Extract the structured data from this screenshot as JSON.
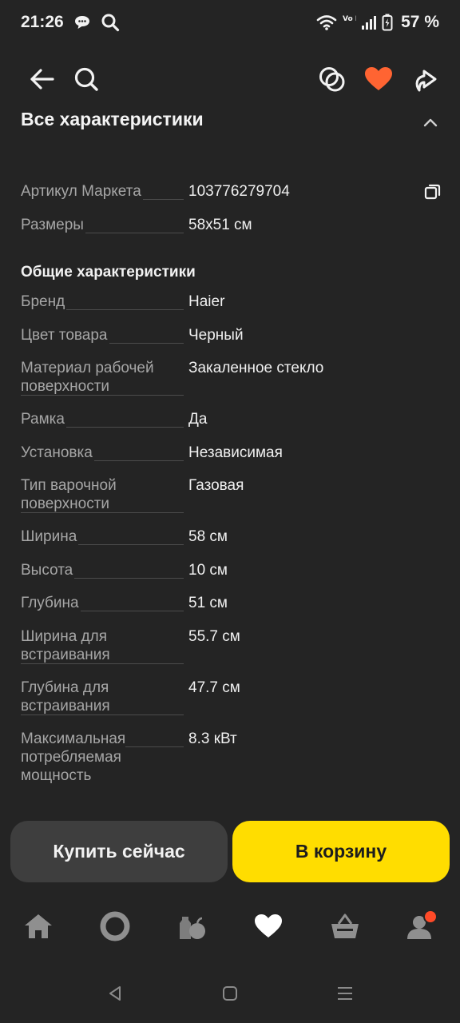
{
  "status_bar": {
    "time": "21:26",
    "network": "Vo LTE",
    "battery": "57 %"
  },
  "app_bar": {
    "back_icon": "arrow-left-icon",
    "search_icon": "search-icon",
    "compare_icon": "compare-circles-icon",
    "favorite_icon": "heart-icon",
    "share_icon": "share-icon",
    "favorite_color": "#ff6432"
  },
  "section": {
    "title": "Все характеристики",
    "collapse_icon": "chevron-up-icon"
  },
  "top_specs": [
    {
      "label": "Артикул Маркета",
      "value": "103776279704"
    },
    {
      "label": "Размеры",
      "value": "58x51 см"
    }
  ],
  "general": {
    "title": "Общие характеристики",
    "items": [
      {
        "label": "Бренд",
        "value": "Haier"
      },
      {
        "label": "Цвет товара",
        "value": "Черный"
      },
      {
        "label": "Материал рабочей поверхности",
        "value": "Закаленное стекло"
      },
      {
        "label": "Рамка",
        "value": "Да"
      },
      {
        "label": "Установка",
        "value": "Независимая"
      },
      {
        "label": "Тип варочной поверхности",
        "value": "Газовая"
      },
      {
        "label": "Ширина",
        "value": "58 см"
      },
      {
        "label": "Высота",
        "value": "10 см"
      },
      {
        "label": "Глубина",
        "value": "51 см"
      },
      {
        "label": "Ширина для встраивания",
        "value": "55.7 см"
      },
      {
        "label": "Глубина для встраивания",
        "value": "47.7 см"
      },
      {
        "label": "Максимальная потребляемая мощность",
        "value": "8.3 кВт"
      }
    ]
  },
  "actions": {
    "buy_now": "Купить сейчас",
    "add_to_cart": "В корзину",
    "cart_color": "#ffdd00"
  },
  "bottom_nav": [
    {
      "icon": "home-icon"
    },
    {
      "icon": "alice-icon"
    },
    {
      "icon": "grocery-icon"
    },
    {
      "icon": "heart-icon"
    },
    {
      "icon": "basket-icon"
    },
    {
      "icon": "profile-icon",
      "badge_color": "#ff4a28"
    }
  ],
  "system_nav": [
    {
      "icon": "back-triangle-icon"
    },
    {
      "icon": "home-square-icon"
    },
    {
      "icon": "menu-lines-icon"
    }
  ]
}
